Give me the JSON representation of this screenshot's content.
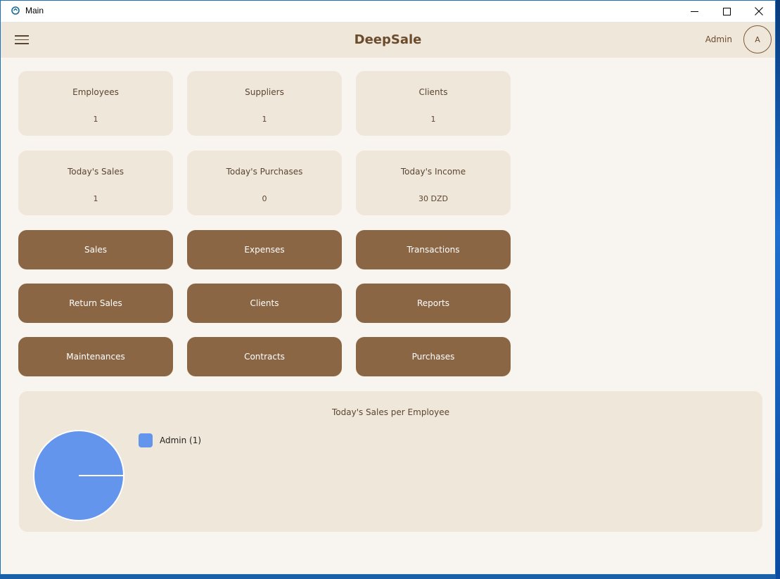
{
  "window": {
    "title": "Main"
  },
  "header": {
    "brand": "DeepSale",
    "user_name": "Admin",
    "avatar_initial": "A"
  },
  "stats": [
    {
      "label": "Employees",
      "value": "1"
    },
    {
      "label": "Suppliers",
      "value": "1"
    },
    {
      "label": "Clients",
      "value": "1"
    },
    {
      "label": "Today's Sales",
      "value": "1"
    },
    {
      "label": "Today's Purchases",
      "value": "0"
    },
    {
      "label": "Today's Income",
      "value": "30 DZD"
    }
  ],
  "actions": [
    "Sales",
    "Expenses",
    "Transactions",
    "Return Sales",
    "Clients",
    "Reports",
    "Maintenances",
    "Contracts",
    "Purchases"
  ],
  "colors": {
    "accent_button": "#8b6644",
    "card_bg": "#efe7da",
    "content_bg": "#f8f4ef",
    "pie_slice": "#6495ed"
  },
  "chart_data": {
    "type": "pie",
    "title": "Today's Sales per Employee",
    "categories": [
      "Admin"
    ],
    "values": [
      1
    ],
    "legend_labels": [
      "Admin (1)"
    ],
    "colors": [
      "#6495ed"
    ],
    "legend": "right"
  }
}
